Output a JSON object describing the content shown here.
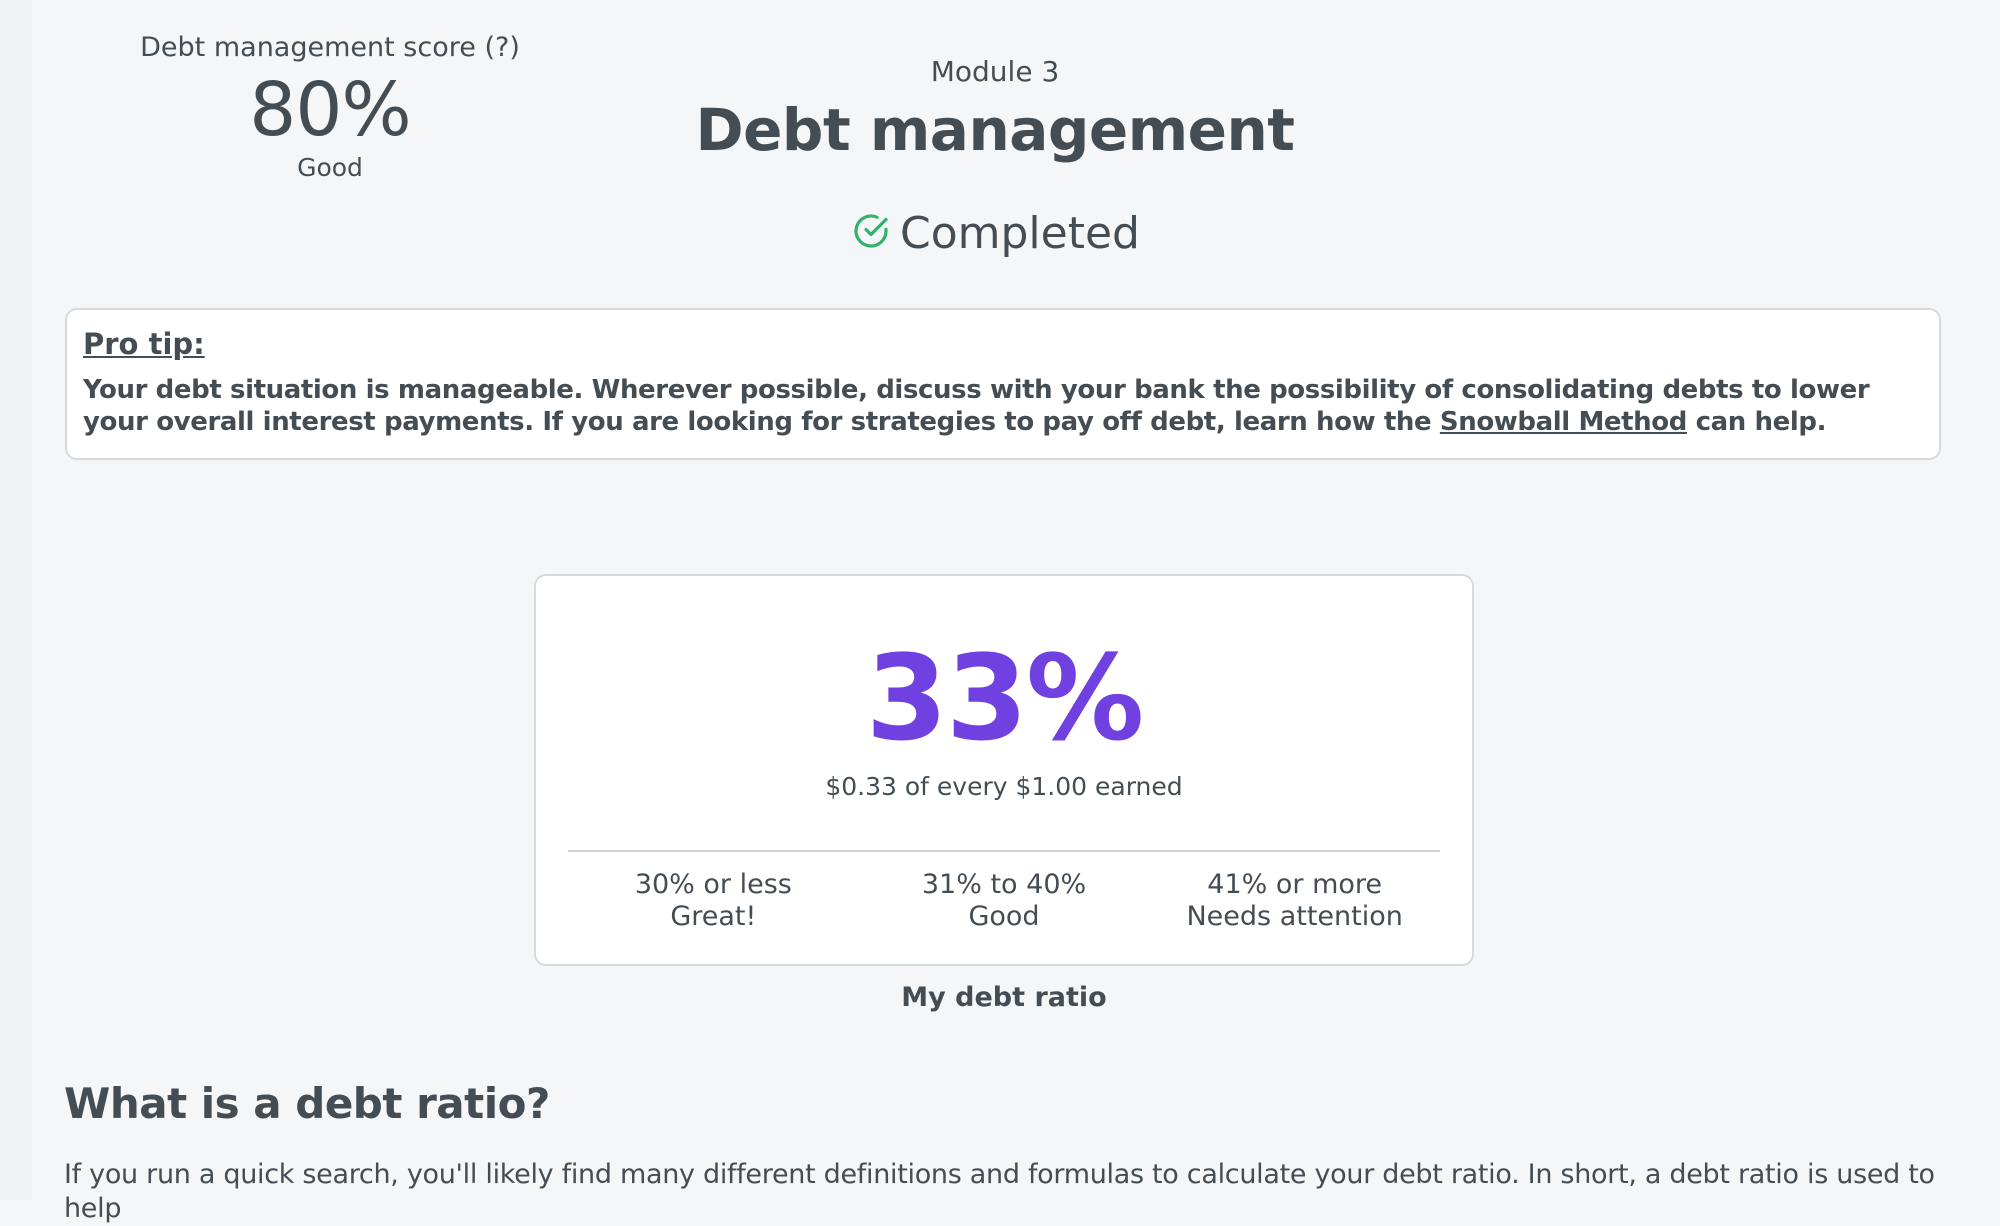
{
  "score": {
    "label": "Debt management score",
    "help": "(?)",
    "value": "80%",
    "rating": "Good"
  },
  "header": {
    "module_label": "Module 3",
    "title": "Debt management",
    "status": "Completed",
    "status_icon": "check-circle-icon",
    "status_color": "#2fb36b"
  },
  "pro_tip": {
    "title": "Pro tip:",
    "body_before_link": "Your debt situation is manageable. Wherever possible, discuss with your bank the possibility of consolidating debts to lower your overall interest payments. If you are looking for strategies to pay off debt, learn how the ",
    "link_text": "Snowball Method",
    "body_after_link": " can help."
  },
  "ratio": {
    "value": "33%",
    "value_color": "#7040e0",
    "subtitle": "$0.33 of every $1.00 earned",
    "scale": [
      {
        "range": "30% or less",
        "rating": "Great!"
      },
      {
        "range": "31% to 40%",
        "rating": "Good"
      },
      {
        "range": "41% or more",
        "rating": "Needs attention"
      }
    ],
    "caption": "My debt ratio"
  },
  "section": {
    "heading": "What is a debt ratio?",
    "body": "If you run a quick search, you'll likely find many different definitions and formulas to calculate your debt ratio. In short, a debt ratio is used to help"
  }
}
